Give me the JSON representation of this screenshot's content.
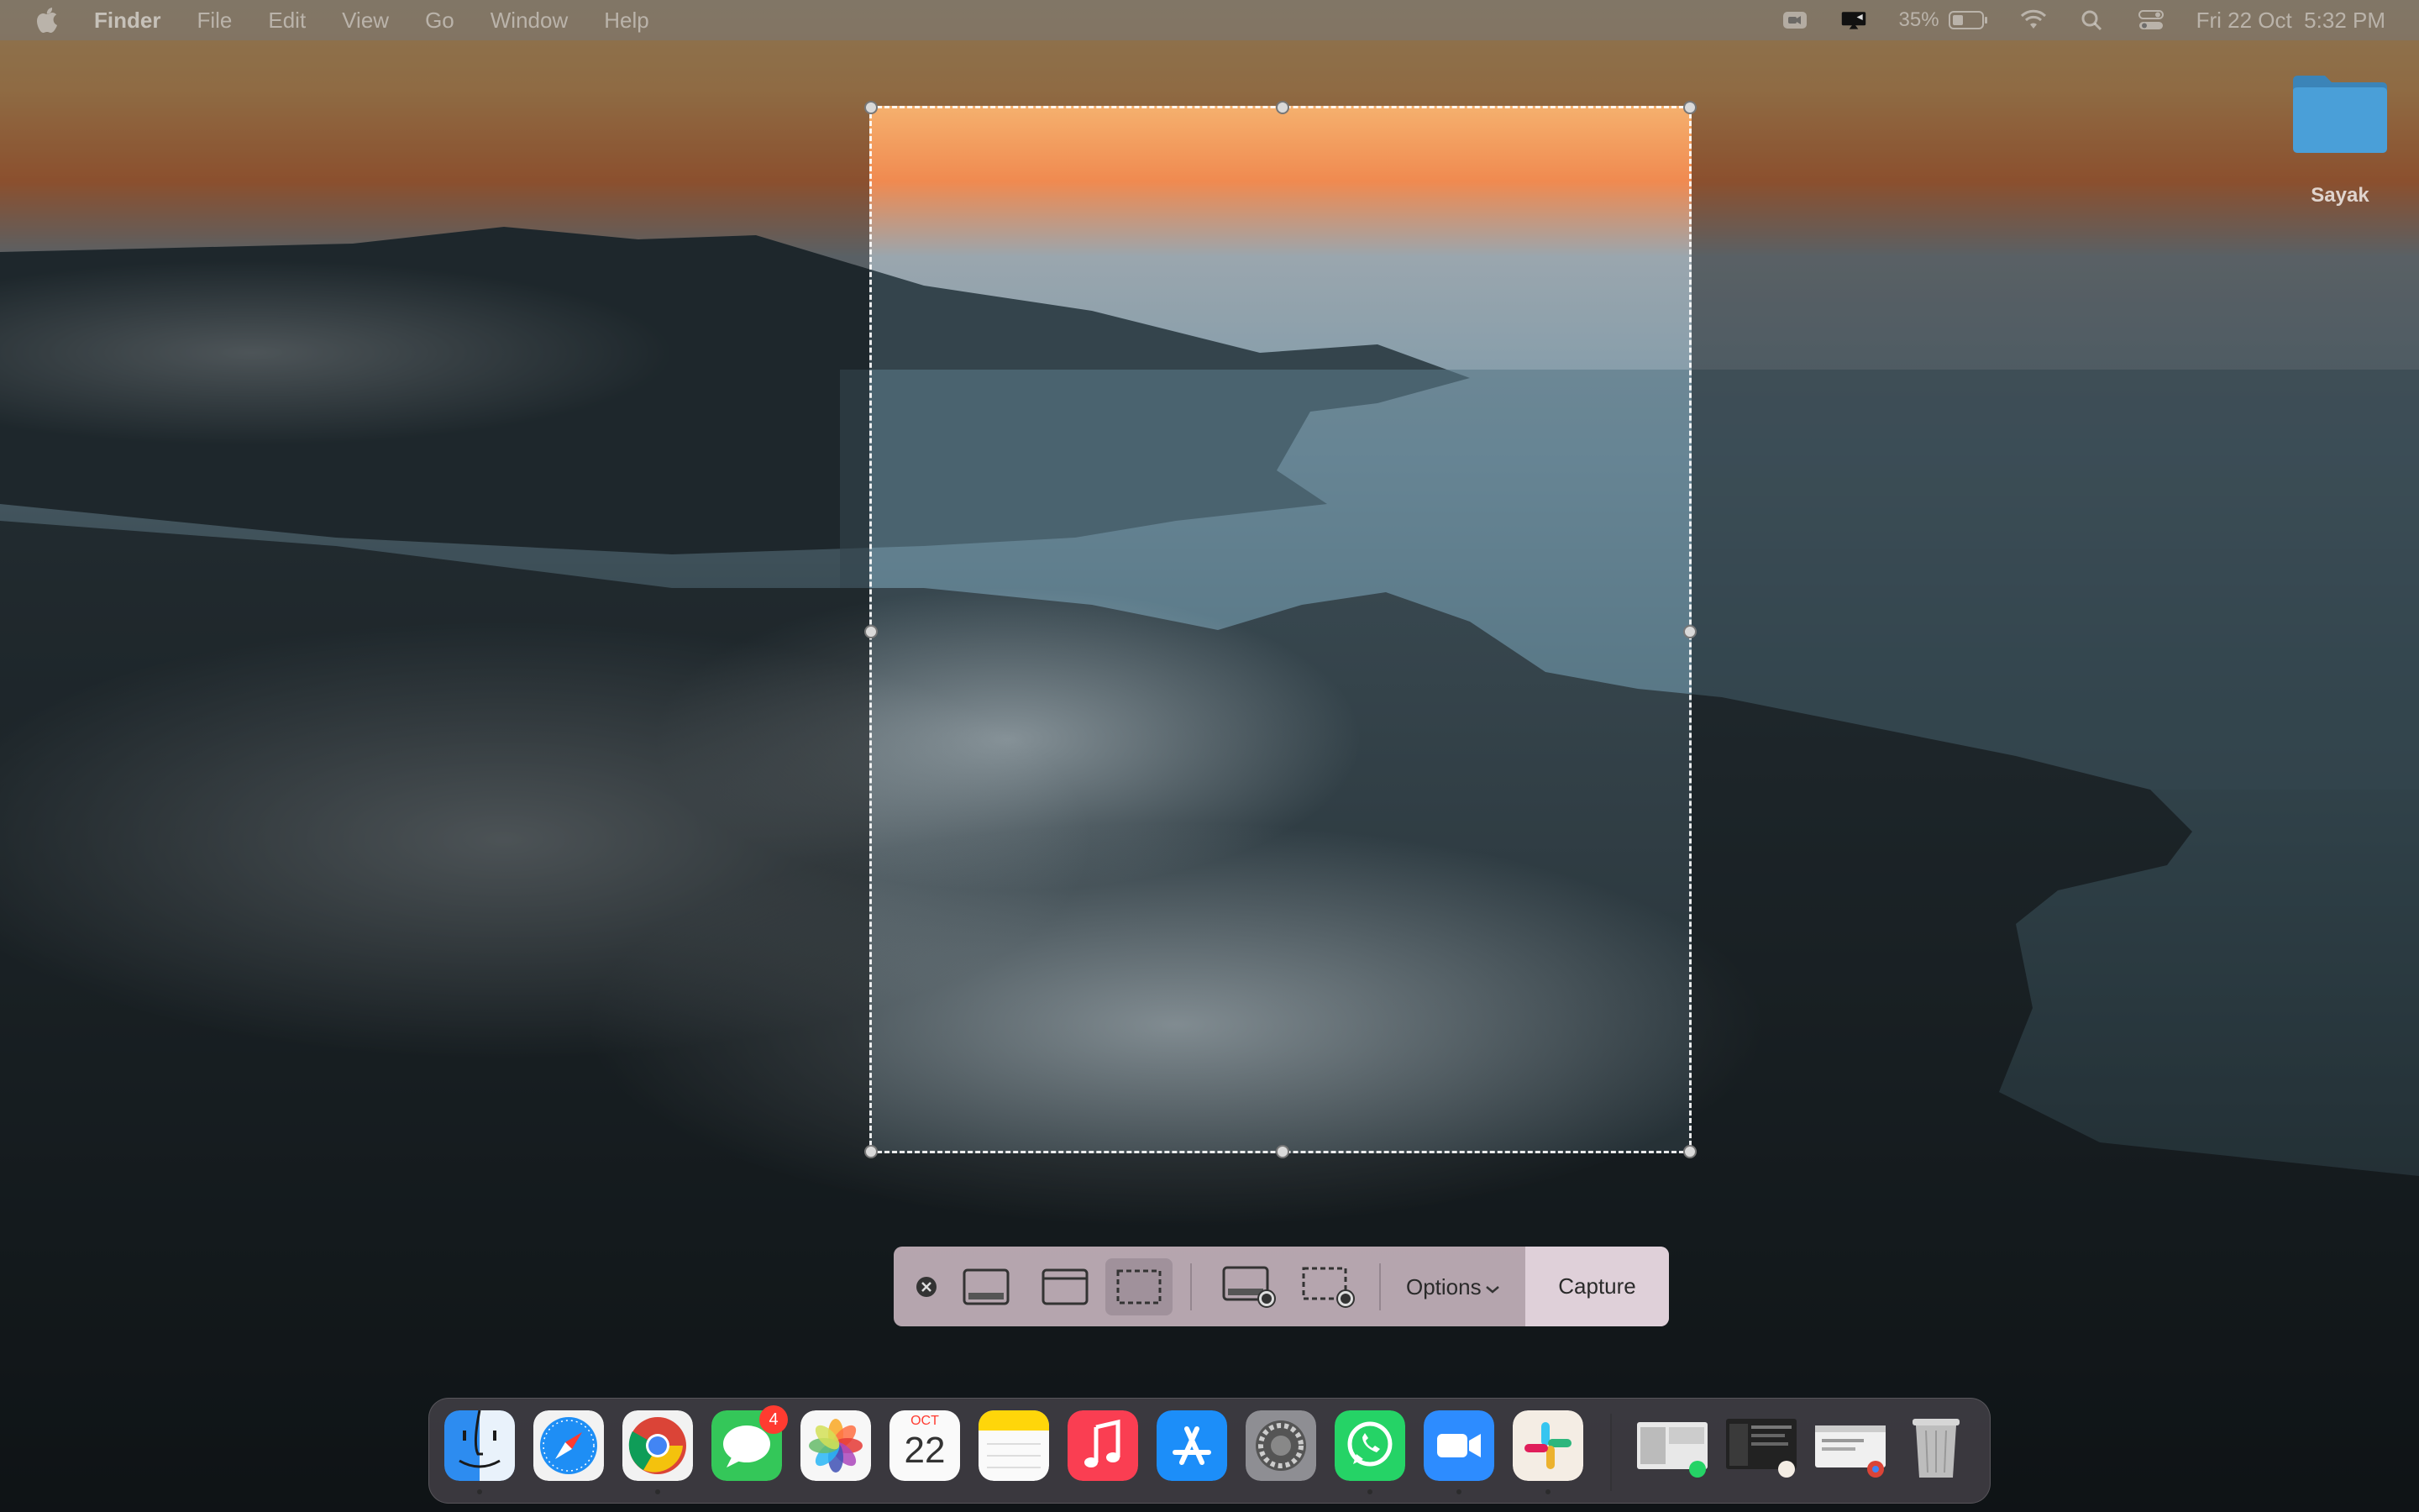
{
  "menubar": {
    "apple_icon": "apple-logo-icon",
    "items": [
      "Finder",
      "File",
      "Edit",
      "View",
      "Go",
      "Window",
      "Help"
    ],
    "status": {
      "battery": "35%",
      "datetime": "Fri 22 Oct  5:32 PM"
    }
  },
  "desktop": {
    "folder_label": "Sayak"
  },
  "screenshot_toolbar": {
    "options_label": "Options",
    "capture_label": "Capture",
    "selected_mode": "capture-selected-portion"
  },
  "dock": {
    "apps": [
      "Finder",
      "Safari",
      "Google Chrome",
      "Messages",
      "Photos",
      "Calendar",
      "Notes",
      "Music",
      "App Store",
      "System Preferences",
      "WhatsApp",
      "Zoom",
      "Slack"
    ],
    "messages_badge": "4",
    "calendar_month": "OCT",
    "calendar_day": "22"
  },
  "colors": {
    "selection_border": "#ffffff",
    "badge": "#ff3b30",
    "folder": "#4a9fd8"
  }
}
